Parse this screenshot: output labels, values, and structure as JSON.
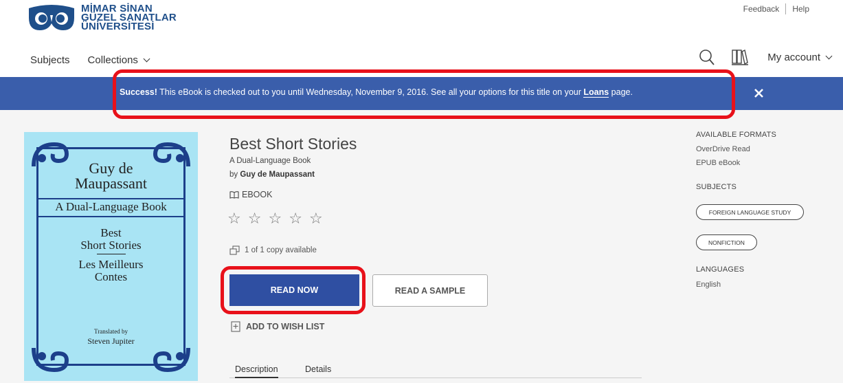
{
  "brand": {
    "line1": "MİMAR SİNAN",
    "line2": "GÜZEL SANATLAR",
    "line3": "ÜNİVERSİTESİ",
    "color": "#1f4f8a"
  },
  "top_links": {
    "feedback": "Feedback",
    "help": "Help"
  },
  "nav": {
    "subjects": "Subjects",
    "collections": "Collections",
    "account": "My account"
  },
  "banner": {
    "strong": "Success!",
    "text": " This eBook is checked out to you until Wednesday, November 9, 2016. See all your options for this title on your ",
    "link": "Loans",
    "tail": " page.",
    "close": "✕",
    "color": "#3a5eab"
  },
  "cover": {
    "author1": "Guy de",
    "author2": "Maupassant",
    "band": "A Dual-Language Book",
    "title1": "Best",
    "title2": "Short Stories",
    "title3": "Les Meilleurs",
    "title4": "Contes",
    "translated_by": "Translated by",
    "translator": "Steven Jupiter"
  },
  "book": {
    "title": "Best Short Stories",
    "subtitle": "A Dual-Language Book",
    "by": "by",
    "author": "Guy de Maupassant",
    "format": "EBOOK",
    "rating": 0,
    "rating_max": 5,
    "copies": "1 of 1 copy available"
  },
  "actions": {
    "read_now": "READ NOW",
    "read_sample": "READ A SAMPLE",
    "wish_list": "ADD TO WISH LIST"
  },
  "tabs": {
    "description": "Description",
    "details": "Details"
  },
  "sidebar": {
    "formats_heading": "AVAILABLE FORMATS",
    "formats": [
      "OverDrive Read",
      "EPUB eBook"
    ],
    "subjects_heading": "SUBJECTS",
    "subjects": [
      "FOREIGN LANGUAGE STUDY",
      "NONFICTION"
    ],
    "languages_heading": "LANGUAGES",
    "languages": [
      "English"
    ]
  },
  "colors": {
    "highlight": "#e8111a",
    "primary_button": "#2f4fa2",
    "cover_bg": "#a9e4f4"
  }
}
